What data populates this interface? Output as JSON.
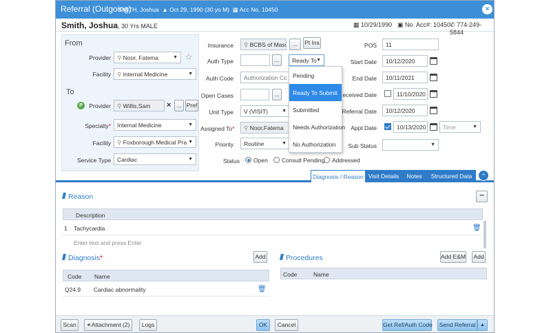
{
  "titlebar": {
    "title": "Referral (Outgoing)",
    "patient_name": "SMITH, Joshua",
    "dob_age": "Oct 29, 1990 (30 yo M)",
    "account": "Acc No. 10450",
    "close_label": "×"
  },
  "patient": {
    "name": "Smith, Joshua",
    "age_sex": ", 30 Yrs MALE",
    "dob": "10/29/1990",
    "status": "No",
    "acc": "Acc#: 10450",
    "phone": "774-249-5844"
  },
  "from": {
    "heading": "From",
    "provider_label": "Provider",
    "provider_value": "Noor, Fatema",
    "facility_label": "Facility",
    "facility_value": "Internal Medicine"
  },
  "to": {
    "heading": "To",
    "provider_label": "Provider",
    "provider_badge": "P",
    "provider_value": "Willis,Sam",
    "clear_label": "×",
    "more_label": "...",
    "pref_label": "Pref",
    "specialty_label": "Specialty",
    "specialty_value": "Internal Medicine",
    "facility_label": "Facility",
    "facility_value": "Foxborough Medical Pra",
    "service_label": "Service Type",
    "service_value": "Cardiac"
  },
  "mid": {
    "insurance_label": "Insurance",
    "insurance_value": "BCBS of Mass",
    "insurance_more": "...",
    "ptins_label": "Pt Ins",
    "authtype_label": "Auth Type",
    "authtype_more": "...",
    "authtype_value": "Ready To",
    "authcode_label": "Auth Code",
    "authcode_placeholder": "Authorization Code",
    "opencases_label": "Open Cases",
    "opencases_more": "...",
    "unittype_label": "Unit Type",
    "unittype_value": "V (VISIT)",
    "assigned_label": "Assigned To",
    "assigned_value": "Noor,Fatema",
    "priority_label": "Priority",
    "priority_value": "Routine",
    "status_label": "Status",
    "status_options": [
      "Open",
      "Consult Pending",
      "Addressed"
    ]
  },
  "dropdown": {
    "items": [
      "Pending",
      "Ready To Submit",
      "Submitted",
      "Needs Authorization",
      "No Authorization"
    ],
    "selected": "Ready To Submit"
  },
  "right": {
    "pos_label": "POS",
    "pos_value": "11",
    "start_label": "Start Date",
    "start_value": "10/12/2020",
    "end_label": "End Date",
    "end_value": "10/11/2021",
    "received_label": "Received Date",
    "received_value": "11/10/2020",
    "referral_label": "Referral Date",
    "referral_value": "10/12/2020",
    "appt_label": "Appt Date",
    "appt_value": "10/13/2020",
    "time_placeholder": "Time",
    "substatus_label": "Sub Status",
    "substatus_value": ""
  },
  "tabs": [
    "Diagnosis / Reason",
    "Visit Details",
    "Notes",
    "Structured Data"
  ],
  "reason": {
    "heading": "Reason",
    "more_label": "•••",
    "column": "Description",
    "rows": [
      {
        "num": "1",
        "text": "Tachycardia"
      }
    ],
    "entry_placeholder": "Enter text and press Enter"
  },
  "diagnosis": {
    "heading": "Diagnosis",
    "add_label": "Add",
    "columns": [
      "Code",
      "Name"
    ],
    "rows": [
      {
        "code": "Q24.9",
        "name": "Cardiac abnormality"
      }
    ]
  },
  "procedures": {
    "heading": "Procedures",
    "addem_label": "Add E&M",
    "add_label": "Add",
    "columns": [
      "Code",
      "Name"
    ]
  },
  "footer": {
    "scan": "Scan",
    "attachment": "Attachment (2)",
    "logs": "Logs",
    "ok": "OK",
    "cancel": "Cancel",
    "get_auth": "Get Ref/Auth Code",
    "send": "Send Referral"
  }
}
